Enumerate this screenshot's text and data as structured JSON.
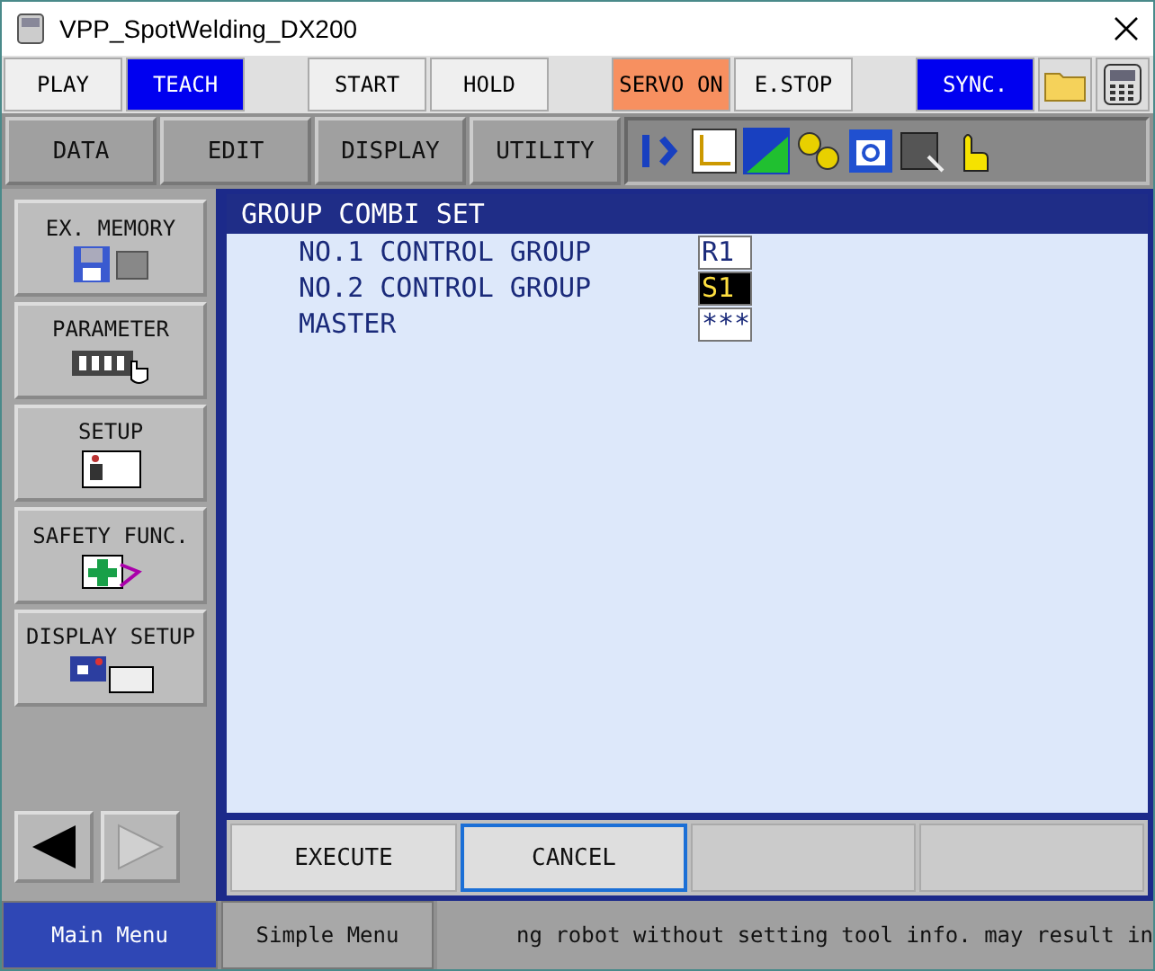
{
  "window": {
    "title": "VPP_SpotWelding_DX200"
  },
  "top_buttons": [
    {
      "label": "PLAY",
      "selected": false,
      "kind": "mode"
    },
    {
      "label": "TEACH",
      "selected": true,
      "kind": "mode"
    },
    {
      "kind": "gap"
    },
    {
      "label": "START",
      "selected": false,
      "kind": "mode"
    },
    {
      "label": "HOLD",
      "selected": false,
      "kind": "mode"
    },
    {
      "kind": "gap"
    },
    {
      "label": "SERVO ON",
      "selected": true,
      "kind": "servo"
    },
    {
      "label": "E.STOP",
      "selected": false,
      "kind": "mode"
    },
    {
      "kind": "gap"
    },
    {
      "label": "SYNC.",
      "selected": true,
      "kind": "mode"
    }
  ],
  "menu_tabs": [
    "DATA",
    "EDIT",
    "DISPLAY",
    "UTILITY"
  ],
  "side_menu": [
    {
      "label": "EX. MEMORY",
      "kind": "memory"
    },
    {
      "label": "PARAMETER",
      "kind": "parameter"
    },
    {
      "label": "SETUP",
      "kind": "setup"
    },
    {
      "label": "SAFETY FUNC.",
      "kind": "safety"
    },
    {
      "label": "DISPLAY SETUP",
      "kind": "display"
    }
  ],
  "panel": {
    "title": "GROUP COMBI SET",
    "rows": [
      {
        "label": "NO.1 CONTROL GROUP",
        "value": "R1",
        "selected": false
      },
      {
        "label": "NO.2 CONTROL GROUP",
        "value": "S1",
        "selected": true
      },
      {
        "label": "MASTER",
        "value": "***",
        "selected": false
      }
    ]
  },
  "actions": [
    {
      "label": "EXECUTE",
      "selected": false
    },
    {
      "label": "CANCEL",
      "selected": true
    }
  ],
  "bottom": {
    "tabs": [
      {
        "label": "Main Menu",
        "selected": true
      },
      {
        "label": "Simple Menu",
        "selected": false
      }
    ],
    "message": "ng robot without setting tool info. may result in"
  }
}
